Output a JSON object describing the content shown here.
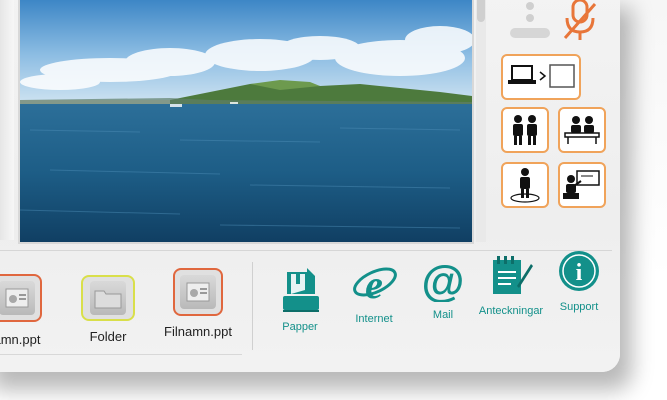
{
  "files": [
    {
      "label": "amn.ppt",
      "type": "ppt",
      "border": "#e0673e"
    },
    {
      "label": "Folder",
      "type": "folder",
      "border": "#d9df4a"
    },
    {
      "label": "Filnamn.ppt",
      "type": "ppt",
      "border": "#e0673e"
    }
  ],
  "tools": [
    {
      "label": "Papper",
      "icon": "paper-hand-icon"
    },
    {
      "label": "Internet",
      "icon": "internet-e-icon"
    },
    {
      "label": "Mail",
      "icon": "at-sign-icon"
    },
    {
      "label": "Anteckningar",
      "icon": "notepad-pen-icon"
    },
    {
      "label": "Support",
      "icon": "info-icon"
    }
  ],
  "modes": [
    {
      "name": "laptop-to-screen",
      "icon": "laptop-to-screen-icon"
    },
    {
      "name": "two-people",
      "icon": "two-people-icon"
    },
    {
      "name": "meeting-table",
      "icon": "meeting-table-icon"
    },
    {
      "name": "single-person",
      "icon": "single-person-spotlight-icon"
    },
    {
      "name": "presenter",
      "icon": "presenter-board-icon"
    }
  ],
  "colors": {
    "accent_teal": "#13908a",
    "accent_orange": "#f0a35a",
    "mic_muted": "#e8763a"
  }
}
